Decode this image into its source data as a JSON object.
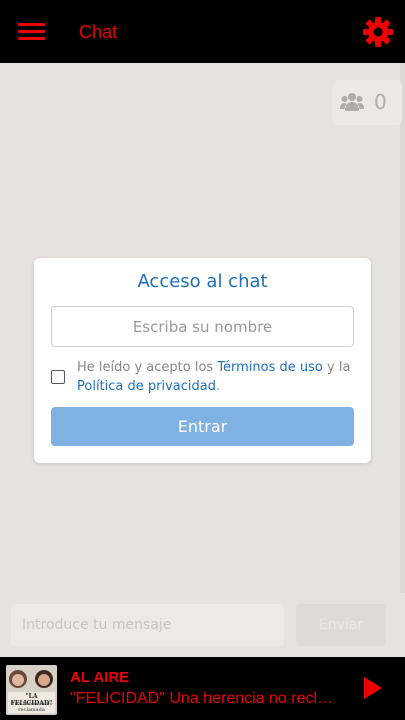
{
  "header": {
    "title": "Chat",
    "menu_icon": "hamburger-menu-icon",
    "settings_icon": "gear-icon",
    "accent_color": "#ee0000"
  },
  "users": {
    "count": "0",
    "icon": "users-icon"
  },
  "login_modal": {
    "title": "Acceso al chat",
    "name_placeholder": "Escriba su nombre",
    "terms_prefix": "He leído y acepto los ",
    "terms_link": "Términos de uso",
    "terms_middle": " y la ",
    "privacy_link": "Política de privacidad",
    "terms_suffix": ".",
    "enter_label": "Entrar",
    "link_color": "#1f6fbf",
    "button_color": "#7fb1e2"
  },
  "composer": {
    "message_placeholder": "Introduce tu mensaje",
    "send_label": "Enviar"
  },
  "player": {
    "status": "AL AIRE",
    "track": "\"FELICIDAD\" Una herencia no reclamada",
    "cover_title": "\"LA FELICIDAD\"",
    "cover_subtitle": "Una herencia no reclamada",
    "play_icon": "play-icon"
  }
}
